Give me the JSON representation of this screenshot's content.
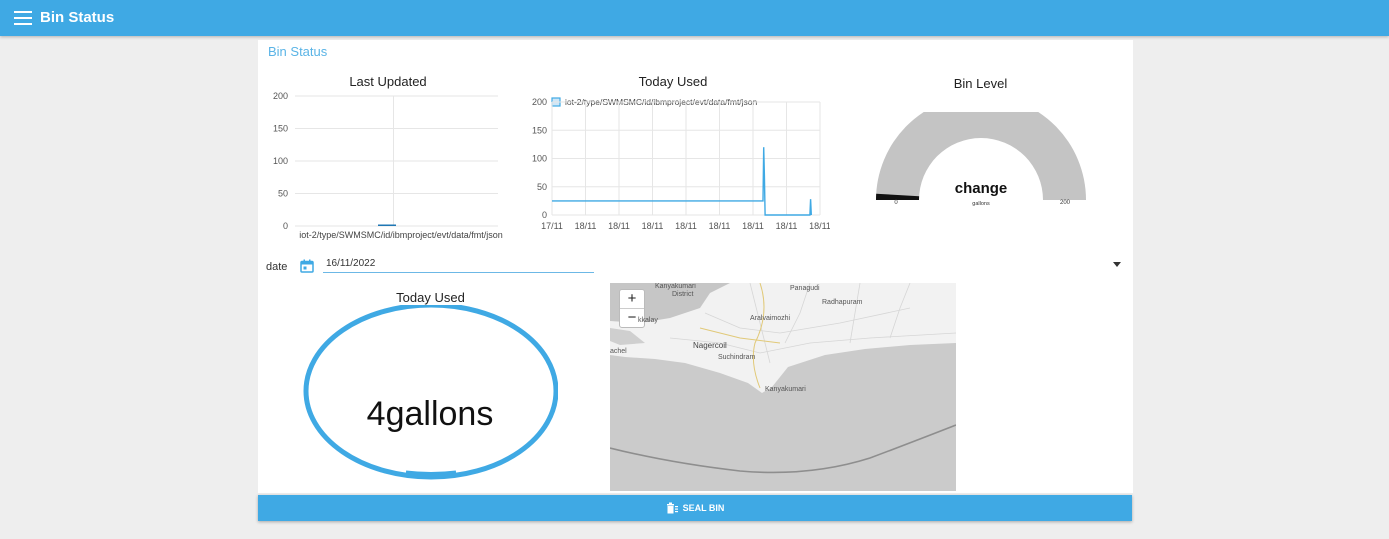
{
  "header": {
    "title": "Bin Status",
    "menu_icon": "menu-icon"
  },
  "group": {
    "title": "Bin Status"
  },
  "chart_last_updated": {
    "title": "Last Updated",
    "y_ticks": [
      "200",
      "150",
      "100",
      "50",
      "0"
    ],
    "x_label": "iot-2/type/SWMSMC/id/ibmproject/evt/data/fmt/json"
  },
  "chart_today_used": {
    "title": "Today Used",
    "legend": "iot-2/type/SWMSMC/id/ibmproject/evt/data/fmt/json",
    "y_ticks": [
      "200",
      "150",
      "100",
      "50",
      "0"
    ],
    "x_ticks": [
      "17/11",
      "18/11",
      "18/11",
      "18/11",
      "18/11",
      "18/11",
      "18/11",
      "18/11",
      "18/11"
    ]
  },
  "gauge": {
    "title": "Bin Level",
    "value_text": "change",
    "min": "0",
    "max": "200",
    "units": "gallons",
    "level": 0.02
  },
  "date_picker": {
    "label": "date",
    "value": "16/11/2022",
    "icon": "calendar-icon"
  },
  "today_used_text": {
    "title": "Today Used",
    "value": "4gallons"
  },
  "map": {
    "zoom_in": "+",
    "zoom_out": "−",
    "labels": {
      "kanyakumari_district": "Kanyakumari",
      "district": "District",
      "panagudi": "Panagudi",
      "radhapuram": "Radhapuram",
      "kalay": "kkalay",
      "aralvaimozhi": "Aralvaimozhi",
      "nagercoil": "Nagercoil",
      "suchindram": "Suchindram",
      "achel": "achel",
      "kanyakumari": "Kanyakumari"
    }
  },
  "seal_button": {
    "label": "SEAL BIN",
    "icon": "bin-icon"
  },
  "chart_data": [
    {
      "type": "bar",
      "title": "Last Updated",
      "categories": [
        "iot-2/type/SWMSMC/id/ibmproject/evt/data/fmt/json"
      ],
      "values": [
        0
      ],
      "ylim": [
        0,
        200
      ]
    },
    {
      "type": "line",
      "title": "Today Used",
      "series": [
        {
          "name": "iot-2/type/SWMSMC/id/ibmproject/evt/data/fmt/json",
          "points": [
            {
              "x": 0.0,
              "y": 25
            },
            {
              "x": 6.3,
              "y": 25
            },
            {
              "x": 6.32,
              "y": 120
            },
            {
              "x": 6.34,
              "y": 70
            },
            {
              "x": 6.36,
              "y": 0
            },
            {
              "x": 7.7,
              "y": 0
            },
            {
              "x": 7.72,
              "y": 28
            },
            {
              "x": 7.74,
              "y": 0
            }
          ]
        }
      ],
      "ylim": [
        0,
        200
      ],
      "x_categories": [
        "17/11",
        "18/11",
        "18/11",
        "18/11",
        "18/11",
        "18/11",
        "18/11",
        "18/11",
        "18/11"
      ],
      "grid": true,
      "legend": "top"
    }
  ]
}
